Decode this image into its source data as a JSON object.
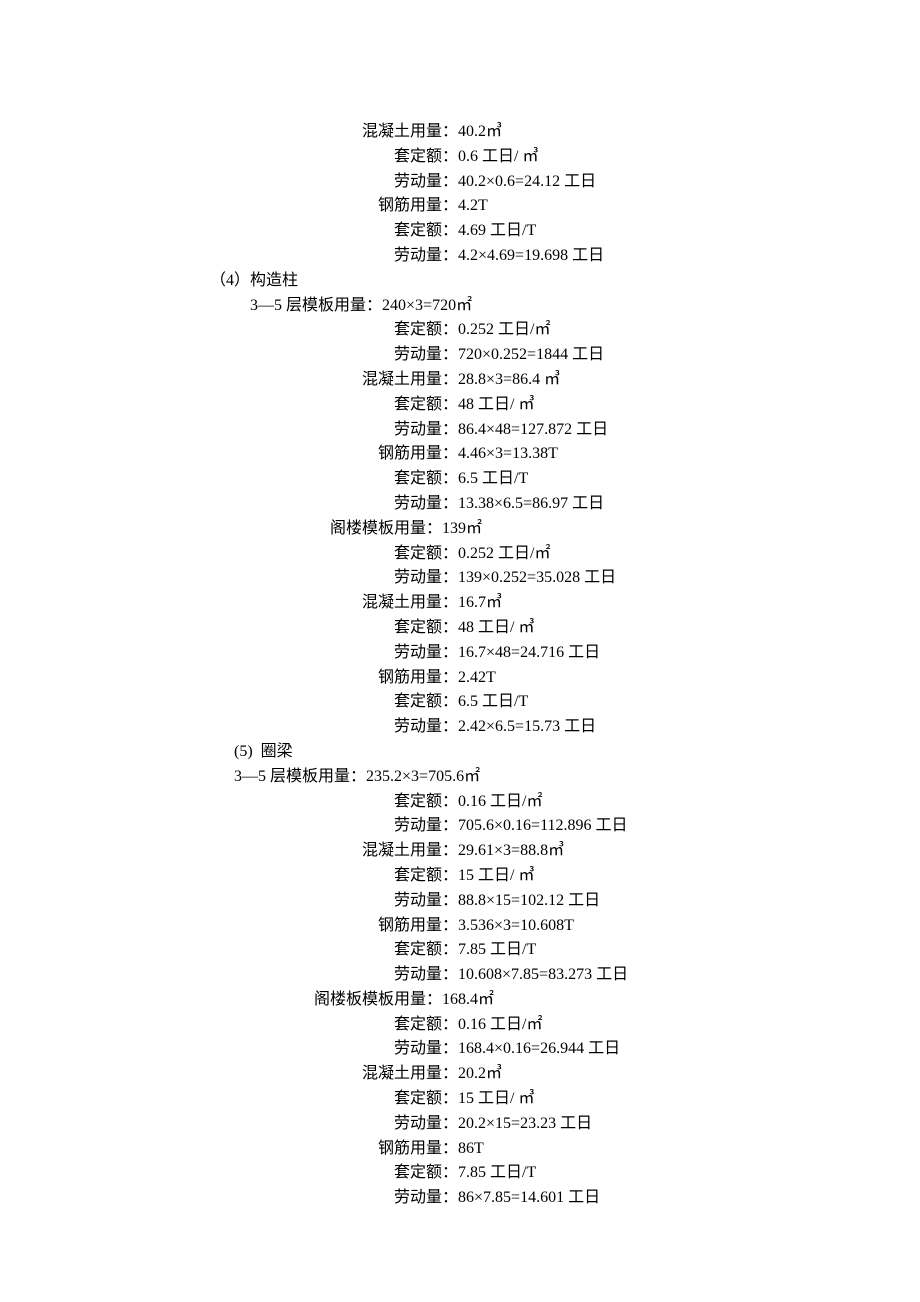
{
  "lines": [
    {
      "indent": 12,
      "label": "混凝土用量：",
      "value": "40.2㎥"
    },
    {
      "indent": 14,
      "label": "套定额：",
      "value": "0.6 工日/ ㎥"
    },
    {
      "indent": 14,
      "label": "劳动量：",
      "value": "40.2×0.6=24.12 工日"
    },
    {
      "indent": 13,
      "label": "钢筋用量：",
      "value": "4.2T"
    },
    {
      "indent": 14,
      "label": "套定额：",
      "value": "4.69 工日/T"
    },
    {
      "indent": 14,
      "label": "劳动量：",
      "value": "4.2×4.69=19.698 工日"
    },
    {
      "indent": 3,
      "label": "（4）构造柱",
      "value": ""
    },
    {
      "indent": 5,
      "label": "3—5 层模板用量：",
      "value": "240×3=720㎡"
    },
    {
      "indent": 14,
      "label": "套定额：",
      "value": "0.252 工日/㎡"
    },
    {
      "indent": 14,
      "label": "劳动量：",
      "value": "720×0.252=1844 工日"
    },
    {
      "indent": 12,
      "label": "混凝土用量：",
      "value": "28.8×3=86.4 ㎥"
    },
    {
      "indent": 14,
      "label": "套定额：",
      "value": "48 工日/ ㎥"
    },
    {
      "indent": 14,
      "label": "劳动量：",
      "value": "86.4×48=127.872 工日"
    },
    {
      "indent": 13,
      "label": "钢筋用量：",
      "value": "4.46×3=13.38T"
    },
    {
      "indent": 14,
      "label": "套定额：",
      "value": "6.5 工日/T"
    },
    {
      "indent": 14,
      "label": "劳动量：",
      "value": "13.38×6.5=86.97 工日"
    },
    {
      "indent": 10,
      "label": "阁楼模板用量：",
      "value": "139㎡"
    },
    {
      "indent": 14,
      "label": "套定额：",
      "value": "0.252 工日/㎡"
    },
    {
      "indent": 14,
      "label": "劳动量：",
      "value": "139×0.252=35.028 工日"
    },
    {
      "indent": 12,
      "label": "混凝土用量：",
      "value": "16.7㎥"
    },
    {
      "indent": 14,
      "label": "套定额：",
      "value": "48 工日/ ㎥"
    },
    {
      "indent": 14,
      "label": "劳动量：",
      "value": "16.7×48=24.716 工日"
    },
    {
      "indent": 13,
      "label": "钢筋用量：",
      "value": "2.42T"
    },
    {
      "indent": 14,
      "label": "套定额：",
      "value": "6.5 工日/T"
    },
    {
      "indent": 14,
      "label": "劳动量：",
      "value": "2.42×6.5=15.73 工日"
    },
    {
      "indent": 4,
      "label": "(5)  圈梁",
      "value": ""
    },
    {
      "indent": 4,
      "label": "3—5 层模板用量：",
      "value": "235.2×3=705.6㎡"
    },
    {
      "indent": 14,
      "label": "套定额：",
      "value": "0.16 工日/㎡"
    },
    {
      "indent": 14,
      "label": "劳动量：",
      "value": "705.6×0.16=112.896 工日"
    },
    {
      "indent": 12,
      "label": "混凝土用量：",
      "value": "29.61×3=88.8㎥"
    },
    {
      "indent": 14,
      "label": "套定额：",
      "value": "15 工日/ ㎥"
    },
    {
      "indent": 14,
      "label": "劳动量：",
      "value": "88.8×15=102.12 工日"
    },
    {
      "indent": 13,
      "label": "钢筋用量：",
      "value": "3.536×3=10.608T"
    },
    {
      "indent": 14,
      "label": "套定额：",
      "value": "7.85 工日/T"
    },
    {
      "indent": 14,
      "label": "劳动量：",
      "value": "10.608×7.85=83.273 工日"
    },
    {
      "indent": 9,
      "label": "阁楼板模板用量：",
      "value": "168.4㎡"
    },
    {
      "indent": 14,
      "label": "套定额：",
      "value": "0.16 工日/㎡"
    },
    {
      "indent": 14,
      "label": "劳动量：",
      "value": "168.4×0.16=26.944 工日"
    },
    {
      "indent": 12,
      "label": "混凝土用量：",
      "value": "20.2㎥"
    },
    {
      "indent": 14,
      "label": "套定额：",
      "value": "15 工日/ ㎥"
    },
    {
      "indent": 14,
      "label": "劳动量：",
      "value": "20.2×15=23.23 工日"
    },
    {
      "indent": 13,
      "label": "钢筋用量：",
      "value": "86T"
    },
    {
      "indent": 14,
      "label": "套定额：",
      "value": "7.85 工日/T"
    },
    {
      "indent": 14,
      "label": "劳动量：",
      "value": "86×7.85=14.601 工日"
    }
  ]
}
